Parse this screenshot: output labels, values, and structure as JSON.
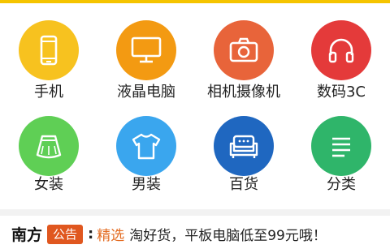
{
  "colors": {
    "top_bar": "#f5c400",
    "phone": "#f7c21f",
    "lcd": "#f39a12",
    "camera": "#e8643a",
    "digital": "#e43a3a",
    "women": "#5fcf55",
    "men": "#3aa6ee",
    "general": "#1f67c0",
    "category": "#2fb56a",
    "badge": "#e0571f",
    "tag": "#e36a1f"
  },
  "categories": [
    {
      "label": "手机",
      "icon": "phone-icon"
    },
    {
      "label": "液晶电脑",
      "icon": "monitor-icon"
    },
    {
      "label": "相机摄像机",
      "icon": "camera-icon"
    },
    {
      "label": "数码3C",
      "icon": "headphones-icon"
    },
    {
      "label": "女装",
      "icon": "skirt-icon"
    },
    {
      "label": "男装",
      "icon": "tshirt-icon"
    },
    {
      "label": "百货",
      "icon": "sofa-icon"
    },
    {
      "label": "分类",
      "icon": "list-icon"
    }
  ],
  "ticker": {
    "brand": "南方",
    "badge": "公告",
    "colon": ":",
    "tag": "精选",
    "text": "淘好货，平板电脑低至99元哦！"
  }
}
